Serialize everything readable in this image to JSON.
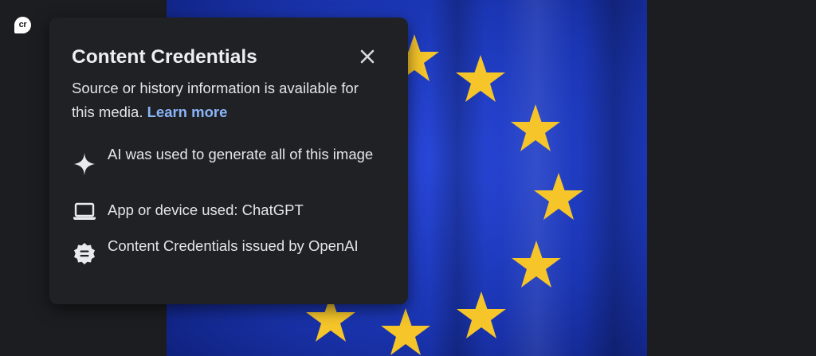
{
  "badge": {
    "label": "cr"
  },
  "popup": {
    "title": "Content Credentials",
    "description": "Source or history information is available for this media.",
    "learn_more": "Learn more",
    "items": [
      {
        "icon": "sparkle-icon",
        "text": "AI was used to generate all of this image"
      },
      {
        "icon": "laptop-icon",
        "text": "App or device used: ChatGPT"
      },
      {
        "icon": "certificate-badge-icon",
        "text": "Content Credentials issued by OpenAI"
      }
    ]
  },
  "colors": {
    "background": "#1c1d20",
    "popup_background": "#202124",
    "link": "#8ab4f8",
    "flag_blue": "#1b3bc0",
    "star_yellow": "#f5c52a"
  }
}
